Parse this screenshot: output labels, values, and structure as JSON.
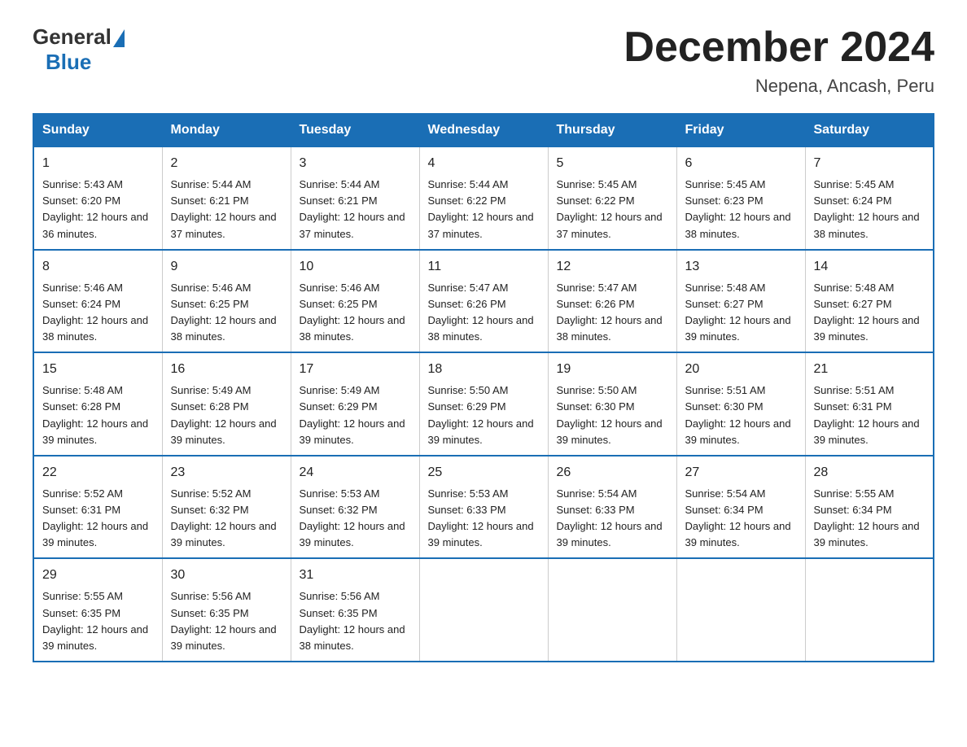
{
  "logo": {
    "general": "General",
    "blue": "Blue"
  },
  "title": "December 2024",
  "subtitle": "Nepena, Ancash, Peru",
  "days_header": [
    "Sunday",
    "Monday",
    "Tuesday",
    "Wednesday",
    "Thursday",
    "Friday",
    "Saturday"
  ],
  "weeks": [
    [
      {
        "day": "1",
        "sunrise": "5:43 AM",
        "sunset": "6:20 PM",
        "daylight": "12 hours and 36 minutes."
      },
      {
        "day": "2",
        "sunrise": "5:44 AM",
        "sunset": "6:21 PM",
        "daylight": "12 hours and 37 minutes."
      },
      {
        "day": "3",
        "sunrise": "5:44 AM",
        "sunset": "6:21 PM",
        "daylight": "12 hours and 37 minutes."
      },
      {
        "day": "4",
        "sunrise": "5:44 AM",
        "sunset": "6:22 PM",
        "daylight": "12 hours and 37 minutes."
      },
      {
        "day": "5",
        "sunrise": "5:45 AM",
        "sunset": "6:22 PM",
        "daylight": "12 hours and 37 minutes."
      },
      {
        "day": "6",
        "sunrise": "5:45 AM",
        "sunset": "6:23 PM",
        "daylight": "12 hours and 38 minutes."
      },
      {
        "day": "7",
        "sunrise": "5:45 AM",
        "sunset": "6:24 PM",
        "daylight": "12 hours and 38 minutes."
      }
    ],
    [
      {
        "day": "8",
        "sunrise": "5:46 AM",
        "sunset": "6:24 PM",
        "daylight": "12 hours and 38 minutes."
      },
      {
        "day": "9",
        "sunrise": "5:46 AM",
        "sunset": "6:25 PM",
        "daylight": "12 hours and 38 minutes."
      },
      {
        "day": "10",
        "sunrise": "5:46 AM",
        "sunset": "6:25 PM",
        "daylight": "12 hours and 38 minutes."
      },
      {
        "day": "11",
        "sunrise": "5:47 AM",
        "sunset": "6:26 PM",
        "daylight": "12 hours and 38 minutes."
      },
      {
        "day": "12",
        "sunrise": "5:47 AM",
        "sunset": "6:26 PM",
        "daylight": "12 hours and 38 minutes."
      },
      {
        "day": "13",
        "sunrise": "5:48 AM",
        "sunset": "6:27 PM",
        "daylight": "12 hours and 39 minutes."
      },
      {
        "day": "14",
        "sunrise": "5:48 AM",
        "sunset": "6:27 PM",
        "daylight": "12 hours and 39 minutes."
      }
    ],
    [
      {
        "day": "15",
        "sunrise": "5:48 AM",
        "sunset": "6:28 PM",
        "daylight": "12 hours and 39 minutes."
      },
      {
        "day": "16",
        "sunrise": "5:49 AM",
        "sunset": "6:28 PM",
        "daylight": "12 hours and 39 minutes."
      },
      {
        "day": "17",
        "sunrise": "5:49 AM",
        "sunset": "6:29 PM",
        "daylight": "12 hours and 39 minutes."
      },
      {
        "day": "18",
        "sunrise": "5:50 AM",
        "sunset": "6:29 PM",
        "daylight": "12 hours and 39 minutes."
      },
      {
        "day": "19",
        "sunrise": "5:50 AM",
        "sunset": "6:30 PM",
        "daylight": "12 hours and 39 minutes."
      },
      {
        "day": "20",
        "sunrise": "5:51 AM",
        "sunset": "6:30 PM",
        "daylight": "12 hours and 39 minutes."
      },
      {
        "day": "21",
        "sunrise": "5:51 AM",
        "sunset": "6:31 PM",
        "daylight": "12 hours and 39 minutes."
      }
    ],
    [
      {
        "day": "22",
        "sunrise": "5:52 AM",
        "sunset": "6:31 PM",
        "daylight": "12 hours and 39 minutes."
      },
      {
        "day": "23",
        "sunrise": "5:52 AM",
        "sunset": "6:32 PM",
        "daylight": "12 hours and 39 minutes."
      },
      {
        "day": "24",
        "sunrise": "5:53 AM",
        "sunset": "6:32 PM",
        "daylight": "12 hours and 39 minutes."
      },
      {
        "day": "25",
        "sunrise": "5:53 AM",
        "sunset": "6:33 PM",
        "daylight": "12 hours and 39 minutes."
      },
      {
        "day": "26",
        "sunrise": "5:54 AM",
        "sunset": "6:33 PM",
        "daylight": "12 hours and 39 minutes."
      },
      {
        "day": "27",
        "sunrise": "5:54 AM",
        "sunset": "6:34 PM",
        "daylight": "12 hours and 39 minutes."
      },
      {
        "day": "28",
        "sunrise": "5:55 AM",
        "sunset": "6:34 PM",
        "daylight": "12 hours and 39 minutes."
      }
    ],
    [
      {
        "day": "29",
        "sunrise": "5:55 AM",
        "sunset": "6:35 PM",
        "daylight": "12 hours and 39 minutes."
      },
      {
        "day": "30",
        "sunrise": "5:56 AM",
        "sunset": "6:35 PM",
        "daylight": "12 hours and 39 minutes."
      },
      {
        "day": "31",
        "sunrise": "5:56 AM",
        "sunset": "6:35 PM",
        "daylight": "12 hours and 38 minutes."
      },
      null,
      null,
      null,
      null
    ]
  ]
}
